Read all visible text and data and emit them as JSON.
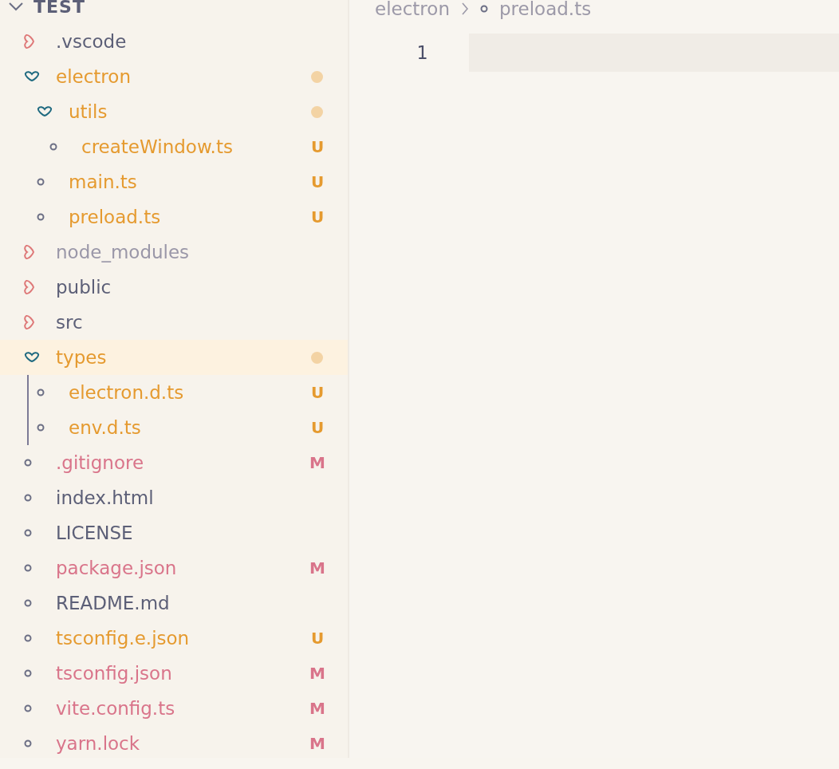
{
  "explorer": {
    "title": "TEST",
    "expanded": true,
    "items": [
      {
        "name": ".vscode",
        "kind": "folder",
        "expanded": false,
        "color": "#5c5f77",
        "dot": false,
        "selected": false
      },
      {
        "name": "electron",
        "kind": "folder",
        "expanded": true,
        "color": "#e59a2f",
        "dot": true,
        "selected": false,
        "children": [
          {
            "name": "utils",
            "kind": "folder",
            "expanded": true,
            "color": "#e59a2f",
            "dot": true,
            "selected": false,
            "children": [
              {
                "name": "createWindow.ts",
                "kind": "file",
                "color": "#e59a2f",
                "badge": "U",
                "selected": false
              }
            ]
          },
          {
            "name": "main.ts",
            "kind": "file",
            "color": "#e59a2f",
            "badge": "U",
            "selected": false
          },
          {
            "name": "preload.ts",
            "kind": "file",
            "color": "#e59a2f",
            "badge": "U",
            "selected": false
          }
        ]
      },
      {
        "name": "node_modules",
        "kind": "folder",
        "expanded": false,
        "color": "#9a97a8",
        "dot": false,
        "selected": false
      },
      {
        "name": "public",
        "kind": "folder",
        "expanded": false,
        "color": "#5c5f77",
        "dot": false,
        "selected": false
      },
      {
        "name": "src",
        "kind": "folder",
        "expanded": false,
        "color": "#5c5f77",
        "dot": false,
        "selected": false
      },
      {
        "name": "types",
        "kind": "folder",
        "expanded": true,
        "color": "#e59a2f",
        "dot": true,
        "selected": true,
        "children": [
          {
            "name": "electron.d.ts",
            "kind": "file",
            "color": "#e59a2f",
            "badge": "U",
            "selected": false
          },
          {
            "name": "env.d.ts",
            "kind": "file",
            "color": "#e59a2f",
            "badge": "U",
            "selected": false
          }
        ]
      },
      {
        "name": ".gitignore",
        "kind": "file",
        "color": "#d9748a",
        "badge": "M",
        "selected": false
      },
      {
        "name": "index.html",
        "kind": "file",
        "color": "#5c5f77",
        "selected": false
      },
      {
        "name": "LICENSE",
        "kind": "file",
        "color": "#5c5f77",
        "selected": false
      },
      {
        "name": "package.json",
        "kind": "file",
        "color": "#d9748a",
        "badge": "M",
        "selected": false
      },
      {
        "name": "README.md",
        "kind": "file",
        "color": "#5c5f77",
        "selected": false
      },
      {
        "name": "tsconfig.e.json",
        "kind": "file",
        "color": "#e59a2f",
        "badge": "U",
        "selected": false
      },
      {
        "name": "tsconfig.json",
        "kind": "file",
        "color": "#d9748a",
        "badge": "M",
        "selected": false
      },
      {
        "name": "vite.config.ts",
        "kind": "file",
        "color": "#d9748a",
        "badge": "M",
        "selected": false
      },
      {
        "name": "yarn.lock",
        "kind": "file",
        "color": "#d9748a",
        "badge": "M",
        "selected": false
      }
    ]
  },
  "editor": {
    "breadcrumb": [
      "electron",
      "preload.ts"
    ],
    "line_numbers": [
      "1"
    ]
  }
}
